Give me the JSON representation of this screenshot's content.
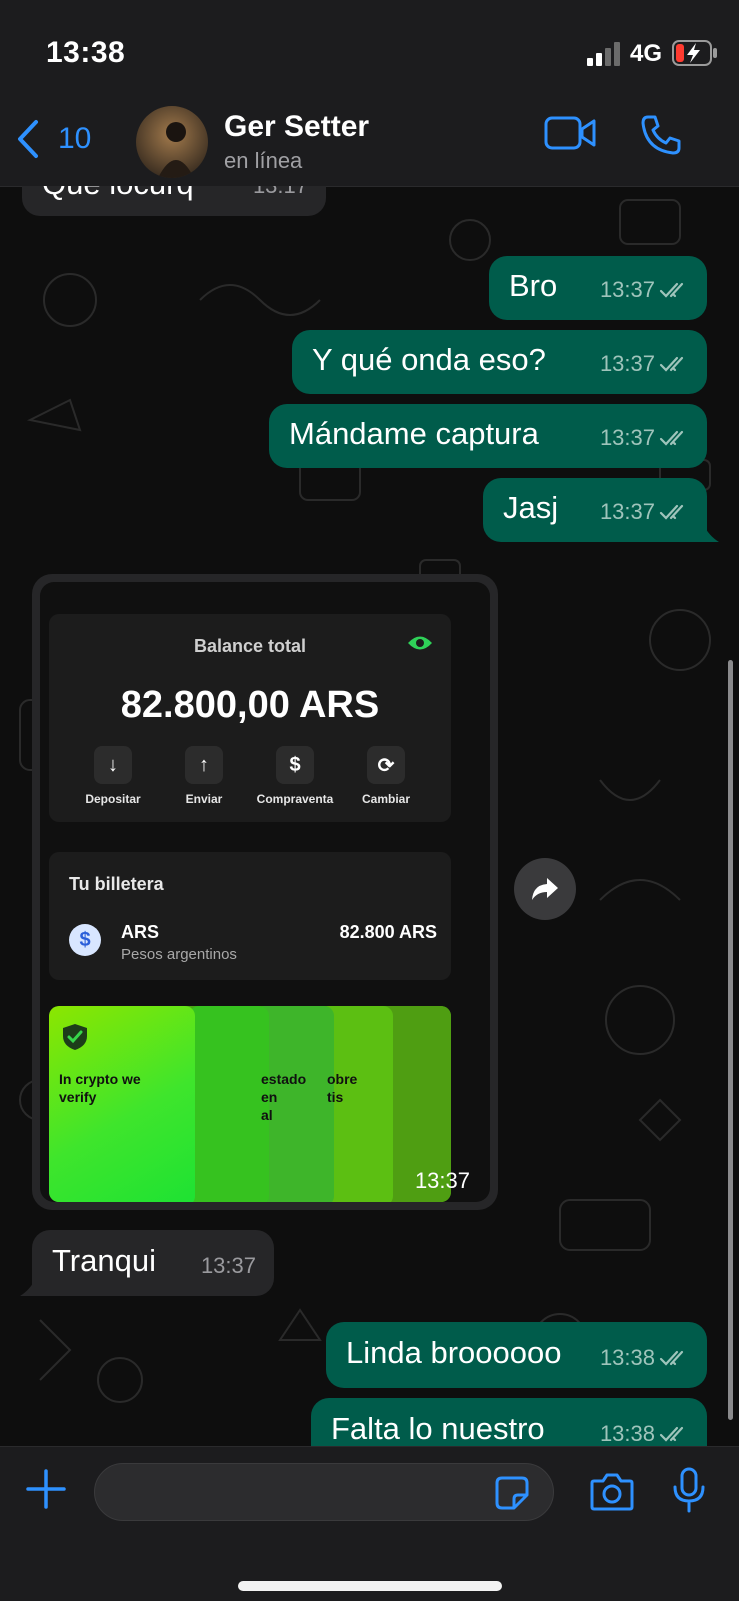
{
  "status_bar": {
    "time": "13:38",
    "network": "4G"
  },
  "header": {
    "back_count": "10",
    "contact_name": "Ger Setter",
    "contact_status": "en línea"
  },
  "messages": [
    {
      "dir": "in",
      "text": "Que locurq",
      "time": "13:17"
    },
    {
      "dir": "out",
      "text": "Bro",
      "time": "13:37"
    },
    {
      "dir": "out",
      "text": "Y qué onda eso?",
      "time": "13:37"
    },
    {
      "dir": "out",
      "text": "Mándame captura",
      "time": "13:37"
    },
    {
      "dir": "out",
      "text": "Jasj",
      "time": "13:37"
    },
    {
      "dir": "in",
      "text": "Tranqui",
      "time": "13:37"
    },
    {
      "dir": "out",
      "text": "Linda broooooo",
      "time": "13:38"
    },
    {
      "dir": "out",
      "text": "Falta lo nuestro",
      "time": "13:38"
    }
  ],
  "image_message": {
    "time": "13:37",
    "screenshot": {
      "balance_title": "Balance total",
      "balance_amount": "82.800,00 ARS",
      "actions": [
        "Depositar",
        "Enviar",
        "Compraventa",
        "Cambiar"
      ],
      "action_glyphs": [
        "↓",
        "↑",
        "$",
        "⟳"
      ],
      "wallet_title": "Tu billetera",
      "currency_code": "ARS",
      "currency_name": "Pesos argentinos",
      "currency_amount": "82.800 ARS",
      "coin_glyph": "$",
      "promo_text_1": "In crypto we verify",
      "promo_text_2": "estado\nen\nal",
      "promo_text_3": "obre\ntis"
    }
  },
  "colors": {
    "accent": "#2e91ff",
    "out_bubble": "#005c4b",
    "in_bubble": "#262628",
    "promo_green": "#39e61e"
  }
}
